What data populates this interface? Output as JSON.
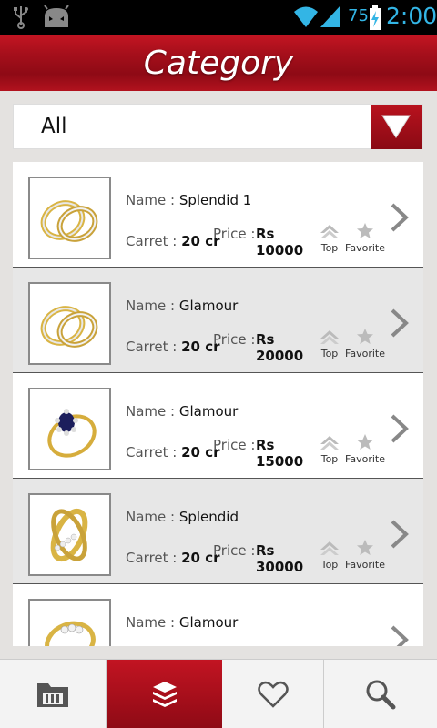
{
  "status_bar": {
    "battery_percent": "75",
    "time": "2:00"
  },
  "header": {
    "title": "Category"
  },
  "category_dropdown": {
    "selected": "All"
  },
  "labels": {
    "name": "Name : ",
    "carret": "Carret : ",
    "price": "Price :",
    "top": "Top",
    "favorite": "Favorite"
  },
  "products": [
    {
      "name": "Splendid 1",
      "carret": "20 cr",
      "price_currency": "Rs",
      "price_value": "10000",
      "ring": "two-tone-bands"
    },
    {
      "name": "Glamour",
      "carret": "20 cr",
      "price_currency": "Rs",
      "price_value": "20000",
      "ring": "two-tone-bands"
    },
    {
      "name": "Glamour",
      "carret": "20 cr",
      "price_currency": "Rs",
      "price_value": "15000",
      "ring": "sapphire-cluster"
    },
    {
      "name": "Splendid",
      "carret": "20 cr",
      "price_currency": "Rs",
      "price_value": "30000",
      "ring": "crossover-diamond"
    },
    {
      "name": "Glamour",
      "carret": "",
      "price_currency": "",
      "price_value": "",
      "ring": "diamond-band"
    }
  ],
  "bottom_nav": {
    "tabs": [
      {
        "icon": "folder-icon",
        "active": false
      },
      {
        "icon": "layers-icon",
        "active": true
      },
      {
        "icon": "heart-icon",
        "active": false
      },
      {
        "icon": "search-icon",
        "active": false
      }
    ]
  },
  "colors": {
    "accent_red": "#a50f1b",
    "status_blue": "#33b5e5"
  }
}
